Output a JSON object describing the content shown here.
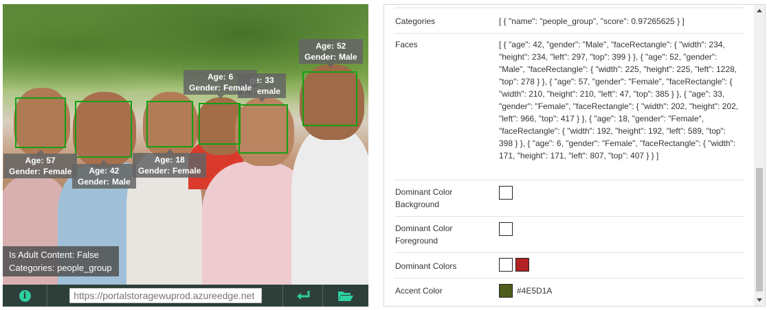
{
  "photo": {
    "faces": [
      {
        "id": "f1",
        "age_label": "Age:",
        "age": "57",
        "gender_label": "Gender:",
        "gender": "Female"
      },
      {
        "id": "f2",
        "age_label": "Age:",
        "age": "42",
        "gender_label": "Gender:",
        "gender": "Male"
      },
      {
        "id": "f3",
        "age_label": "Age:",
        "age": "18",
        "gender_label": "Gender:",
        "gender": "Female"
      },
      {
        "id": "f4",
        "age_label": "Age:",
        "age": "6",
        "gender_label": "Gender:",
        "gender": "Female"
      },
      {
        "id": "f5",
        "age_label": "ge:",
        "age": "33",
        "gender_label": "r:",
        "gender": "Female"
      },
      {
        "id": "f6",
        "age_label": "Age:",
        "age": "52",
        "gender_label": "Gender:",
        "gender": "Male"
      }
    ],
    "info": {
      "adult": "Is Adult Content: False",
      "categories": "Categories: people_group"
    }
  },
  "toolbar": {
    "info_icon": "info-icon",
    "url_placeholder": "https://portalstoragewuprod.azureedge.net",
    "enter_icon": "enter-arrow-icon",
    "folder_icon": "folder-open-icon"
  },
  "results": {
    "rows": [
      {
        "key": "Categories",
        "value": "[ { \"name\": \"people_group\", \"score\": 0.97265625 } ]"
      },
      {
        "key": "Faces",
        "value": "[ { \"age\": 42, \"gender\": \"Male\", \"faceRectangle\": { \"width\": 234, \"height\": 234, \"left\": 297, \"top\": 399 } }, { \"age\": 52, \"gender\": \"Male\", \"faceRectangle\": { \"width\": 225, \"height\": 225, \"left\": 1228, \"top\": 278 } }, { \"age\": 57, \"gender\": \"Female\", \"faceRectangle\": { \"width\": 210, \"height\": 210, \"left\": 47, \"top\": 385 } }, { \"age\": 33, \"gender\": \"Female\", \"faceRectangle\": { \"width\": 202, \"height\": 202, \"left\": 966, \"top\": 417 } }, { \"age\": 18, \"gender\": \"Female\", \"faceRectangle\": { \"width\": 192, \"height\": 192, \"left\": 589, \"top\": 398 } }, { \"age\": 6, \"gender\": \"Female\", \"faceRectangle\": { \"width\": 171, \"height\": 171, \"left\": 807, \"top\": 407 } } ]"
      },
      {
        "key": "Dominant Color Background",
        "swatch": "#ffffff"
      },
      {
        "key": "Dominant Color Foreground",
        "swatch": "#ffffff"
      },
      {
        "key": "Dominant Colors",
        "swatches": [
          "#ffffff",
          "#b22222"
        ]
      },
      {
        "key": "Accent Color",
        "swatch": "#4E5D1A",
        "value": "#4E5D1A"
      }
    ]
  },
  "colors": {
    "face_box": "#14a014",
    "toolbar_bg": "#2e3f3a",
    "icon_accent": "#2ed0a0"
  }
}
